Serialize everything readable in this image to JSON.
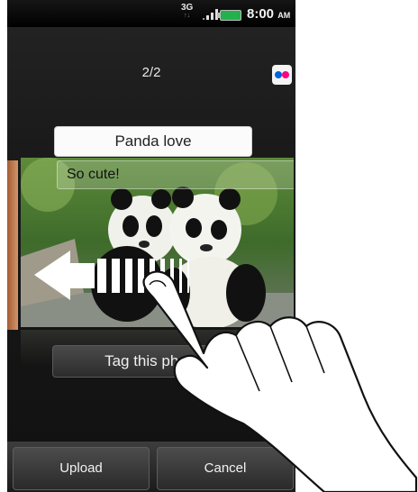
{
  "status_bar": {
    "network": "3G",
    "time": "8:00",
    "ampm": "AM"
  },
  "header": {
    "counter": "2/2",
    "service_icon": "flickr-icon"
  },
  "photo": {
    "title_value": "Panda love",
    "caption": "So cute!"
  },
  "actions": {
    "tag_label": "Tag this photo",
    "upload_label": "Upload",
    "cancel_label": "Cancel"
  },
  "overlay": {
    "gesture": "swipe-left-hand-icon"
  },
  "colors": {
    "flickr_blue": "#0063dc",
    "flickr_pink": "#ff0084",
    "battery": "#22b14c"
  }
}
